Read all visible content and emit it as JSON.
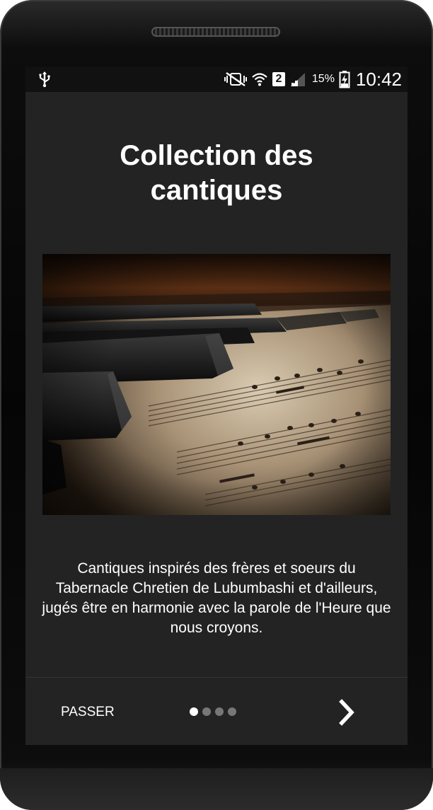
{
  "status_bar": {
    "left_icon": "usb-icon",
    "right_icons": [
      "mute-vibrate-icon",
      "wifi-icon",
      "sim-badge",
      "signal-icon",
      "battery-charging-icon"
    ],
    "sim_number": "2",
    "battery_percent": "15%",
    "time": "10:42"
  },
  "onboarding": {
    "title_lines": [
      "Collection des",
      "cantiques"
    ],
    "image": "piano-sheet-music-image",
    "description": "Cantiques inspirés des frères et soeurs du Tabernacle Chretien de Lubumbashi et d'ailleurs, jugés être en harmonie avec la parole de l'Heure que nous croyons.",
    "skip_label": "PASSER",
    "page_count": 4,
    "current_page": 1,
    "next_icon": "chevron-right-icon"
  },
  "colors": {
    "screen_background": "#232323",
    "status_bar": "#111111",
    "text": "#ffffff",
    "dot_inactive": "#777777",
    "dot_active": "#ffffff"
  }
}
